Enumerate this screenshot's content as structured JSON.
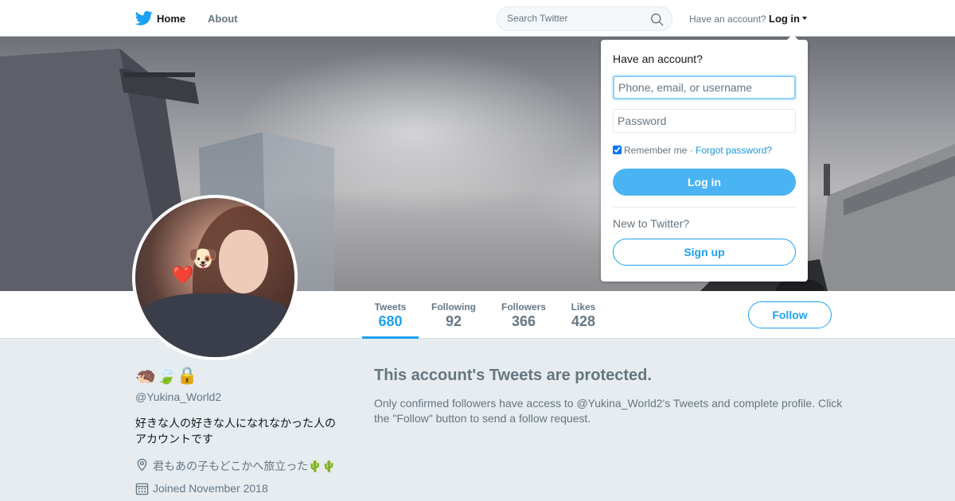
{
  "nav": {
    "home_label": "Home",
    "about_label": "About",
    "search_placeholder": "Search Twitter",
    "account_prompt": "Have an account?",
    "login_label": "Log in",
    "logo_icon": "twitter-bird-icon",
    "brand_color": "#1da1f2"
  },
  "login_dropdown": {
    "heading": "Have an account?",
    "username_placeholder": "Phone, email, or username",
    "password_placeholder": "Password",
    "remember_label": "Remember me ·",
    "remember_checked": true,
    "forgot_link": "Forgot password?",
    "login_button": "Log in",
    "new_prompt": "New to Twitter?",
    "signup_button": "Sign up"
  },
  "profile": {
    "name_emojis": "🦔🍃🔒",
    "screen_name": "@Yukina_World2",
    "bio": "好きな人の好きな人になれなかった人のアカウントです",
    "location": "君もあの子もどこかへ旅立った🌵🌵",
    "joined": "Joined November 2018",
    "avatar_emojis": {
      "dog": "🐶",
      "heart": "❤️"
    }
  },
  "stats": [
    {
      "label": "Tweets",
      "value": "680",
      "active": true
    },
    {
      "label": "Following",
      "value": "92",
      "active": false
    },
    {
      "label": "Followers",
      "value": "366",
      "active": false
    },
    {
      "label": "Likes",
      "value": "428",
      "active": false
    }
  ],
  "follow_button": "Follow",
  "protected": {
    "title": "This account's Tweets are protected.",
    "body": "Only confirmed followers have access to @Yukina_World2's Tweets and complete profile. Click the \"Follow\" button to send a follow request."
  }
}
